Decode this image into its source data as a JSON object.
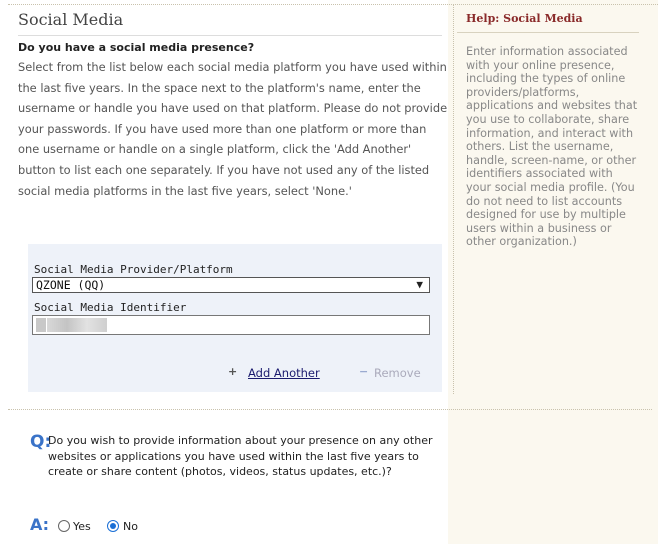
{
  "section": {
    "title": "Social Media",
    "question": "Do you have a social media presence?",
    "instructions": "Select from the list below each social media platform you have used within the last five years. In the space next to the platform's name, enter the username or handle you have used on that platform. Please do not provide your passwords. If you have used more than one platform or more than one username or handle on a single platform, click the 'Add Another' button to list each one separately. If you have not used any of the listed social media platforms in the last five years, select 'None.'"
  },
  "form": {
    "platform_label": "Social Media Provider/Platform",
    "platform_value": "QZONE (QQ)",
    "identifier_label": "Social Media Identifier",
    "identifier_value": "",
    "add_label": "Add Another",
    "remove_label": "Remove",
    "plus_icon": "+",
    "minus_icon": "−"
  },
  "followup": {
    "q_marker": "Q:",
    "question": "Do you wish to provide information about your presence on any other websites or applications you have used within the last five years to create or share content (photos, videos, status updates, etc.)?",
    "a_marker": "A:",
    "options": [
      "Yes",
      "No"
    ],
    "selected": "No"
  },
  "help": {
    "title": "Help: Social Media",
    "body": "Enter information associated with your online presence, including the types of online providers/platforms, applications and websites that you use to collaborate, share information, and interact with others. List the username, handle, screen-name, or other identifiers associated with your social media profile. (You do not need to list accounts designed for use by multiple users within a business or other organization.)"
  },
  "colors": {
    "accent": "#3a73c8",
    "help_title": "#8a2a2a",
    "field_bg": "#eef2f9",
    "page_bg": "#fbf8ef"
  }
}
